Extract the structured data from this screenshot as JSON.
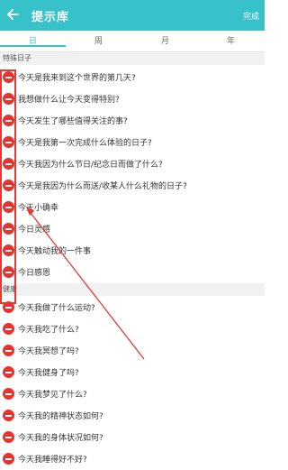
{
  "header": {
    "title": "提示库",
    "done_label": "完成"
  },
  "tabs": [
    {
      "label": "日",
      "active": true
    },
    {
      "label": "周",
      "active": false
    },
    {
      "label": "月",
      "active": false
    },
    {
      "label": "年",
      "active": false
    }
  ],
  "sections": [
    {
      "title": "特殊日子",
      "items": [
        "今天是我来到这个世界的第几天?",
        "我想做什么让今天变得特别?",
        "今天发生了哪些值得关注的事?",
        "今天是我第一次完成什么体验的日子?",
        "今天我因为什么节日/纪念日而做了什么?",
        "今天是我因为什么而送/收某人什么礼物的日子?",
        "今天小确幸",
        "今日灵感",
        "今天触动我的一件事",
        "今日感恩"
      ]
    },
    {
      "title": "健康",
      "items": [
        "今天我做了什么运动?",
        "今天我吃了什么?",
        "今天我冥想了吗?",
        "今天我健身了吗?",
        "今天我梦见了什么?",
        "今天我的精神状态如何?",
        "今天我的身体状况如何?",
        "今天我睡得好不好?"
      ]
    }
  ],
  "colors": {
    "accent": "#36c2c8",
    "delete": "#e8322e",
    "annotation": "#e53935"
  },
  "icons": {
    "back": "back-arrow-icon",
    "delete": "minus-circle-icon"
  }
}
